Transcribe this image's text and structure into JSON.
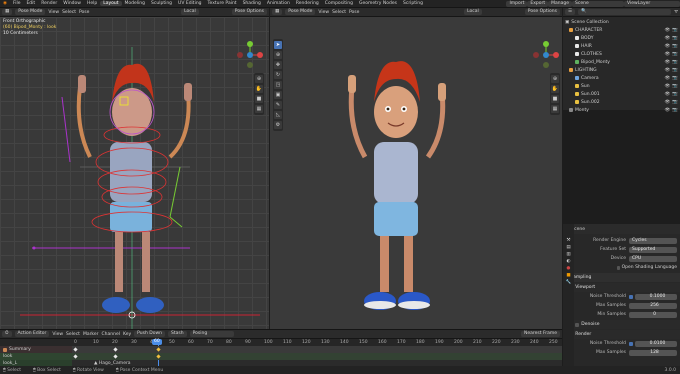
{
  "menu": {
    "items": [
      "File",
      "Edit",
      "Render",
      "Window",
      "Help"
    ],
    "workspaces": [
      "Layout",
      "Modeling",
      "Sculpting",
      "UV Editing",
      "Texture Paint",
      "Shading",
      "Animation",
      "Rendering",
      "Compositing",
      "Geometry Nodes",
      "Scripting"
    ],
    "active_workspace": "Layout",
    "scene_label": "Scene",
    "view_layer_label": "ViewLayer",
    "import_label": "Import",
    "export_label": "Export",
    "manage_label": "Manage"
  },
  "left_view": {
    "mode": "Pose Mode",
    "menus": [
      "View",
      "Select",
      "Pose"
    ],
    "orientation": "Local",
    "options": "Pose Options",
    "overlay": {
      "line1": "Front Orthographic",
      "line2": "(60) Bipod_Monty : look",
      "line3": "10 Centimeters"
    }
  },
  "right_view": {
    "mode": "Pose Mode",
    "menus": [
      "View",
      "Select",
      "Pose"
    ],
    "orientation": "Local",
    "options": "Pose Options"
  },
  "outliner": {
    "title": "Scene Collection",
    "items": [
      {
        "label": "CHARACTER",
        "depth": 0
      },
      {
        "label": "BODY",
        "depth": 1
      },
      {
        "label": "HAIR",
        "depth": 1
      },
      {
        "label": "CLOTHES",
        "depth": 1
      },
      {
        "label": "Bipod_Monty",
        "depth": 1
      },
      {
        "label": "LIGHTING",
        "depth": 0
      },
      {
        "label": "Camera",
        "depth": 1
      },
      {
        "label": "Sun",
        "depth": 1
      },
      {
        "label": "Sun.001",
        "depth": 1
      },
      {
        "label": "Sun.002",
        "depth": 1
      },
      {
        "label": "Monty",
        "depth": 0
      }
    ]
  },
  "properties": {
    "title": "Scene",
    "render_engine": {
      "label": "Render Engine",
      "value": "Cycles"
    },
    "feature_set": {
      "label": "Feature Set",
      "value": "Supported"
    },
    "device": {
      "label": "Device",
      "value": "CPU"
    },
    "osl_label": "Open Shading Language",
    "sampling_label": "Sampling",
    "viewport_label": "Viewport",
    "noise_threshold": {
      "label": "Noise Threshold",
      "value": "0.1000"
    },
    "max_samples": {
      "label": "Max Samples",
      "value": "256"
    },
    "min_samples": {
      "label": "Min Samples",
      "value": "0"
    },
    "denoise_label": "Denoise",
    "render_label": "Render",
    "render_noise": {
      "label": "Noise Threshold",
      "value": "0.0100"
    },
    "render_max": {
      "label": "Max Samples",
      "value": "128"
    }
  },
  "timeline": {
    "editor": "Action Editor",
    "menus": [
      "View",
      "Select",
      "Marker",
      "Channel",
      "Key"
    ],
    "push_down": "Push Down",
    "stash": "Stash",
    "action": "Posing",
    "frames": [
      "0",
      "10",
      "20",
      "30",
      "40",
      "50",
      "60",
      "70",
      "80",
      "90",
      "100",
      "110",
      "120",
      "130",
      "140",
      "150",
      "160",
      "170",
      "180",
      "190",
      "200",
      "210",
      "220",
      "230",
      "240",
      "250"
    ],
    "current_frame": "60",
    "channels": [
      "Summary",
      "look",
      "look_L"
    ],
    "marker": "Hago_Camera",
    "playback": "Nearest Frame"
  },
  "status": {
    "left": "Select",
    "middle": "Box Select",
    "rotate": "Rotate View",
    "ctx": "Pose Context Menu",
    "version": "3.0.0"
  }
}
